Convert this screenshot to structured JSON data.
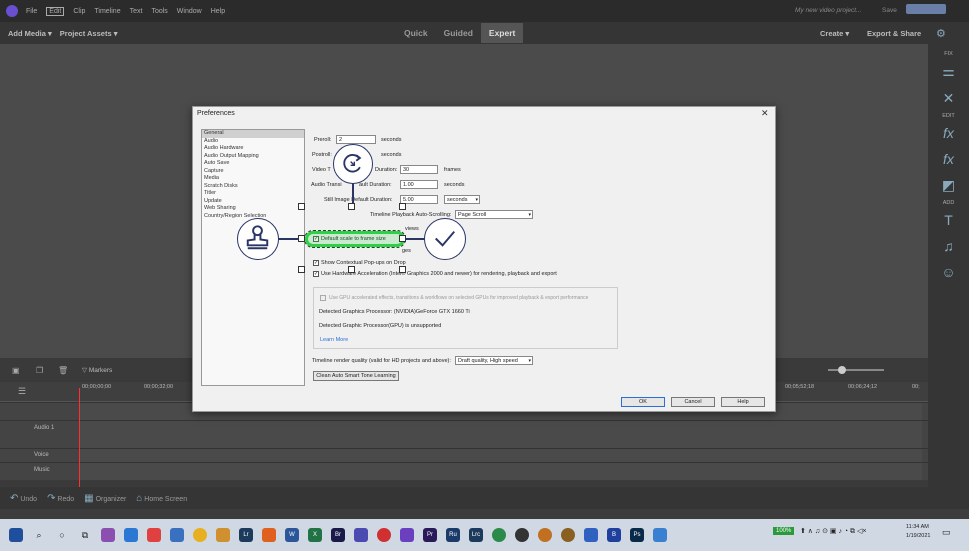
{
  "menubar": {
    "items": [
      "File",
      "Edit",
      "Clip",
      "Timeline",
      "Text",
      "Tools",
      "Window",
      "Help"
    ],
    "project_name": "My new video project...",
    "save": "Save"
  },
  "toolbar": {
    "add_media": "Add Media ▾",
    "project_assets": "Project Assets ▾",
    "modes": [
      "Quick",
      "Guided",
      "Expert"
    ],
    "create": "Create ▾",
    "export_share": "Export & Share"
  },
  "right_panel": {
    "fix": "FIX",
    "edit": "EDIT",
    "add": "ADD"
  },
  "timeline": {
    "markers": "Markers",
    "time_start": "00;00;00;00",
    "time_2": "00;00;32;00",
    "time_right1": "00;05;52;18",
    "time_right2": "00;06;24;12",
    "time_right3": "00;",
    "tracks": [
      "",
      "Audio 1",
      "Voice",
      "Music"
    ]
  },
  "appbar": {
    "undo": "Undo",
    "redo": "Redo",
    "organizer": "Organizer",
    "home": "Home Screen"
  },
  "dialog": {
    "title": "Preferences",
    "categories": [
      "General",
      "Audio",
      "Audio Hardware",
      "Audio Output Mapping",
      "Auto Save",
      "Capture",
      "Media",
      "Scratch Disks",
      "Titler",
      "Update",
      "Web Sharing",
      "Country/Region Selection"
    ],
    "preroll_label": "Preroll:",
    "preroll_value": "2",
    "preroll_unit": "seconds",
    "postroll_label": "Postroll:",
    "postroll_unit": "seconds",
    "video_label_a": "Video T",
    "video_label_b": "Duration:",
    "video_value": "30",
    "video_unit": "frames",
    "audio_label_a": "Audio Transi",
    "audio_label_b": "ault Duration:",
    "audio_value": "1.00",
    "audio_unit": "seconds",
    "still_label": "Still Image Default Duration:",
    "still_value": "5.00",
    "still_unit": "seconds",
    "scroll_label": "Timeline Playback Auto-Scrolling:",
    "scroll_value": "Page Scroll",
    "views_tail": "views",
    "default_scale": "Default scale to frame size",
    "ges_tail": "ges",
    "contextual": "Show Contextual Pop-ups on Drop",
    "hw_accel": "Use Hardware Acceleration (Intel® Graphics 2000 and newer) for rendering, playback and export",
    "gpu_effects": "Use GPU accelerated effects, transitions & workflows on selected GPUs for improved playback & export performance",
    "detected_gpu": "Detected Graphics Processor:  (NVIDIA)GeForce GTX 1660 Ti",
    "unsupported": "Detected Graphic Processor(GPU) is unsupported",
    "learn_more": "Learn More",
    "render_quality_label": "Timeline render quality (valid for HD projects and above):",
    "render_quality_value": "Draft quality, High speed",
    "clean_button": "Clean Auto Smart Tone Learning",
    "ok": "OK",
    "cancel": "Cancel",
    "help": "Help"
  },
  "taskbar": {
    "zoom": "100%",
    "time": "11:34 AM",
    "date": "1/19/2021"
  },
  "colors": {
    "highlight": "#2ed046",
    "gizmo": "#2a3566",
    "playhead": "#ff3030"
  }
}
